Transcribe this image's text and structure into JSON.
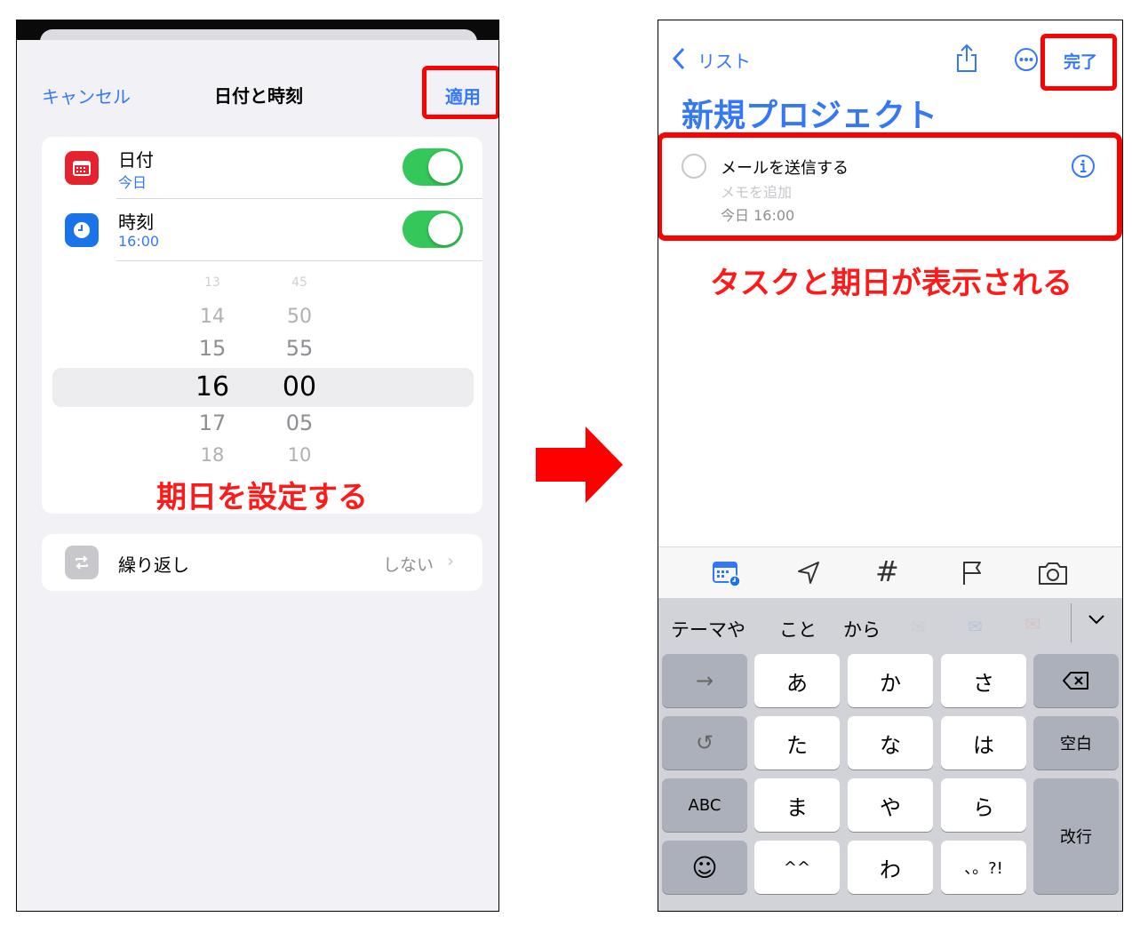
{
  "left": {
    "nav": {
      "cancel": "キャンセル",
      "title": "日付と時刻",
      "apply": "適用"
    },
    "date_row": {
      "title": "日付",
      "value": "今日",
      "toggle_on": true
    },
    "time_row": {
      "title": "時刻",
      "value": "16:00",
      "toggle_on": true
    },
    "picker": {
      "hours": [
        "13",
        "14",
        "15",
        "16",
        "17",
        "18"
      ],
      "minutes": [
        "45",
        "50",
        "55",
        "00",
        "05",
        "10"
      ]
    },
    "annotation": "期日を設定する",
    "repeat": {
      "label": "繰り返し",
      "value": "しない"
    }
  },
  "right": {
    "nav": {
      "back": "リスト",
      "done": "完了"
    },
    "title": "新規プロジェクト",
    "task": {
      "title": "メールを送信する",
      "memo_placeholder": "メモを追加",
      "date": "今日 16:00"
    },
    "annotation": "タスクと期日が表示される",
    "toolbar_icons": [
      "calendar-icon",
      "location-icon",
      "tag-icon",
      "flag-icon",
      "camera-icon"
    ],
    "keyboard": {
      "suggestions": [
        "テーマや",
        "こと",
        "から"
      ],
      "rows": [
        [
          "→",
          "あ",
          "か",
          "さ",
          "⌫"
        ],
        [
          "↺",
          "た",
          "な",
          "は",
          "空白"
        ],
        [
          "ABC",
          "ま",
          "や",
          "ら",
          "改行"
        ],
        [
          "☺",
          "^^",
          "わ",
          "、。?!"
        ]
      ]
    }
  },
  "colors": {
    "accent": "#3478f6",
    "highlight": "#ff0000",
    "toggle": "#34c759",
    "date_icon": "#e5232f",
    "time_icon": "#1a73e8"
  }
}
